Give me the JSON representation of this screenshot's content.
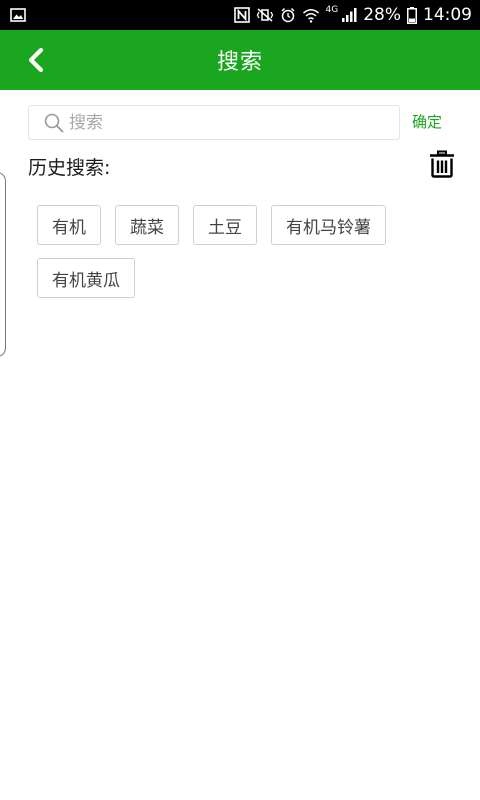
{
  "status_bar": {
    "network": "4G",
    "battery": "28%",
    "time": "14:09"
  },
  "header": {
    "title": "搜索"
  },
  "search": {
    "placeholder": "搜索",
    "value": "",
    "confirm_label": "确定"
  },
  "history": {
    "title": "历史搜索:",
    "tags": [
      "有机",
      "蔬菜",
      "土豆",
      "有机马铃薯",
      "有机黄瓜"
    ]
  },
  "colors": {
    "brand_green": "#1aa61f",
    "status_bar_bg": "#000000"
  },
  "icons": {
    "back": "back-chevron-icon",
    "search": "search-icon",
    "trash": "trash-icon"
  }
}
